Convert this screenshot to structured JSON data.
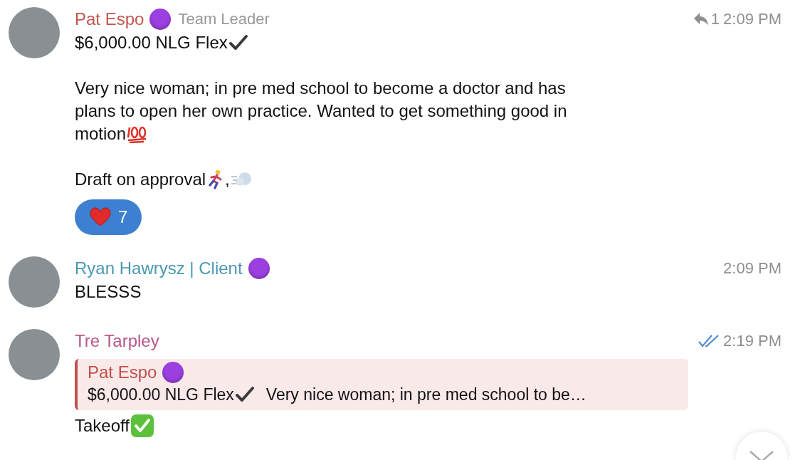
{
  "messages": [
    {
      "author": "Pat Espo",
      "color": "#c0574f",
      "badge": true,
      "role": "Team Leader",
      "reply_count": "1",
      "time": "2:09 PM",
      "read": false,
      "paragraphs": [
        [
          [
            {
              "kind": "text",
              "text": "$6,000.00 NLG Flex"
            },
            {
              "kind": "check"
            }
          ]
        ],
        [
          [
            {
              "kind": "text",
              "text": "Very nice woman; in pre med school to become a doctor and has"
            }
          ],
          [
            {
              "kind": "text",
              "text": "plans to open her own practice. Wanted to get something good in"
            }
          ],
          [
            {
              "kind": "text",
              "text": "motion"
            },
            {
              "kind": "hundred"
            }
          ]
        ],
        [
          [
            {
              "kind": "text",
              "text": "Draft on approval"
            },
            {
              "kind": "runner"
            },
            {
              "kind": "text",
              "text": ","
            },
            {
              "kind": "wind"
            }
          ]
        ]
      ],
      "reactions": [
        {
          "kind": "heart",
          "count": "7",
          "selected": true
        }
      ]
    },
    {
      "author": "Ryan Hawrysz | Client",
      "color": "#4a9ab2",
      "badge": true,
      "time": "2:09 PM",
      "read": false,
      "paragraphs": [
        [
          [
            {
              "kind": "text",
              "text": "BLESSS"
            }
          ]
        ]
      ]
    },
    {
      "author": "Tre Tarpley",
      "color": "#b8568a",
      "badge": false,
      "time": "2:19 PM",
      "read": true,
      "quote": {
        "author": "Pat Espo",
        "badge": true,
        "color": "#c0504d",
        "parts": [
          {
            "kind": "text",
            "text": "$6,000.00 NLG Flex"
          },
          {
            "kind": "check"
          },
          {
            "kind": "text",
            "text": "Very nice woman; in pre med school to be…"
          }
        ]
      },
      "paragraphs": [
        [
          [
            {
              "kind": "text",
              "text": "Takeoff"
            },
            {
              "kind": "greencheck"
            }
          ]
        ]
      ]
    }
  ]
}
